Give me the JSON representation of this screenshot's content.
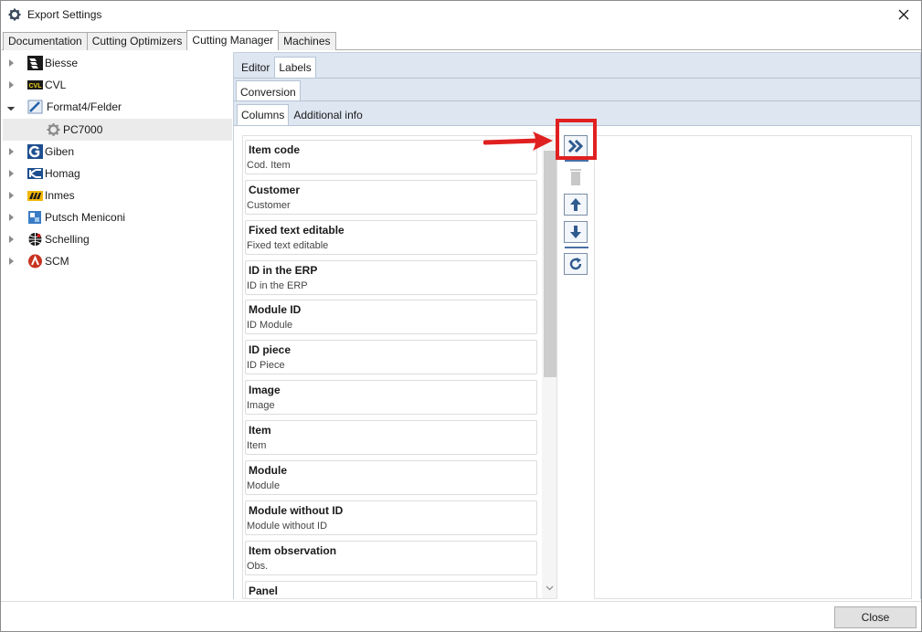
{
  "window": {
    "title": "Export Settings"
  },
  "main_tabs": [
    {
      "label": "Documentation"
    },
    {
      "label": "Cutting Optimizers"
    },
    {
      "label": "Cutting Manager"
    },
    {
      "label": "Machines"
    }
  ],
  "tree": [
    {
      "label": "Biesse",
      "logo": "biesse-logo"
    },
    {
      "label": "CVL",
      "logo": "cvl-logo"
    },
    {
      "label": "Format4/Felder",
      "logo": "format4-logo"
    },
    {
      "label": "PC7000",
      "logo": "gear-icon"
    },
    {
      "label": "Giben",
      "logo": "giben-logo"
    },
    {
      "label": "Homag",
      "logo": "homag-logo"
    },
    {
      "label": "Inmes",
      "logo": "inmes-logo"
    },
    {
      "label": "Putsch Meniconi",
      "logo": "putsch-logo"
    },
    {
      "label": "Schelling",
      "logo": "schelling-logo"
    },
    {
      "label": "SCM",
      "logo": "scm-logo"
    }
  ],
  "editor_tabs": [
    {
      "label": "Editor"
    },
    {
      "label": "Labels"
    }
  ],
  "conversion_tab": {
    "label": "Conversion"
  },
  "column_tabs": [
    {
      "label": "Columns"
    },
    {
      "label": "Additional info"
    }
  ],
  "columns": [
    {
      "name": "Item code",
      "sub": "Cod. Item"
    },
    {
      "name": "Customer",
      "sub": "Customer"
    },
    {
      "name": "Fixed text editable",
      "sub": "Fixed text editable"
    },
    {
      "name": "ID in the ERP",
      "sub": "ID in the ERP"
    },
    {
      "name": "Module ID",
      "sub": "ID Module"
    },
    {
      "name": "ID piece",
      "sub": "ID Piece"
    },
    {
      "name": "Image",
      "sub": "Image"
    },
    {
      "name": "Item",
      "sub": "Item"
    },
    {
      "name": "Module",
      "sub": "Module"
    },
    {
      "name": "Module without ID",
      "sub": "Module without ID"
    },
    {
      "name": "Item observation",
      "sub": "Obs."
    },
    {
      "name": "Panel",
      "sub": ""
    }
  ],
  "toolbar": {
    "add_all_icon": "double-chevron-right-icon",
    "delete_icon": "trash-icon",
    "up_icon": "arrow-up-icon",
    "down_icon": "arrow-down-icon",
    "refresh_icon": "refresh-icon"
  },
  "footer": {
    "close_label": "Close"
  },
  "colors": {
    "accent": "#2f5b8f",
    "highlight": "#e02020",
    "panel_bg": "#dde6f1"
  }
}
